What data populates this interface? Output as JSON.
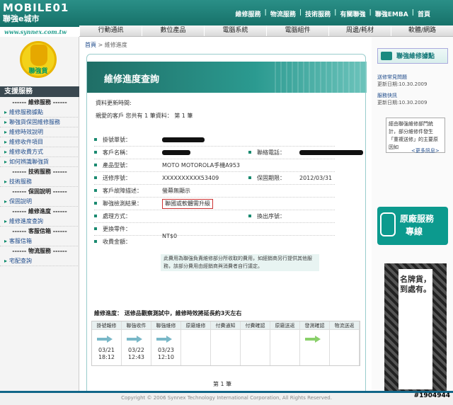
{
  "header": {
    "logo_top": "MOBILE01",
    "logo_bottom": "聯強e城市",
    "url": "www.synnex.com.tw",
    "nav": [
      "維修服務",
      "物流服務",
      "技術服務",
      "有關聯強",
      "聯強EMBA",
      "首頁"
    ]
  },
  "catnav": [
    "行動通訊",
    "數位產品",
    "電腦系統",
    "電腦組件",
    "周邊/耗材",
    "軟體/網路"
  ],
  "sidebar": {
    "badge": "聯強貨",
    "title": "支援服務",
    "groups": [
      {
        "hd": "------ 維修服務 ------",
        "items": [
          "維修服務據點",
          "聯強貨保固維修服務",
          "維修時效說明",
          "維修收件項目",
          "維修收費方式",
          "如何辨識聯強貨"
        ]
      },
      {
        "hd": "------ 技術服務 ------",
        "items": [
          "技術服務"
        ]
      },
      {
        "hd": "------ 保固說明 ------",
        "items": [
          "保固說明"
        ]
      },
      {
        "hd": "------ 維修進度 ------",
        "items": [
          "維修進度查詢"
        ]
      },
      {
        "hd": "------ 客服信箱 ------",
        "items": [
          "客服信箱"
        ]
      },
      {
        "hd": "------ 物流服務 ------",
        "items": [
          "宅配查詢"
        ]
      }
    ]
  },
  "main": {
    "crumb_home": "首頁",
    "crumb_sep": " > ",
    "crumb_cur": "維修進度",
    "panel_title": "維修進度查詢",
    "update_label": "資料更新時間:",
    "greeting": "親愛的客戶 您共有 1 筆資料：  第 1 筆",
    "rows": [
      {
        "k": "掛號單號：",
        "redact": 60
      },
      {
        "k": "客戶名稱：",
        "redact": 40,
        "k2": "聯絡電話：",
        "redact2": 90
      },
      {
        "k": "產品型號：",
        "v": "MOTO MOTOROLA手機A953"
      },
      {
        "k": "送修序號：",
        "v": "XXXXXXXXXX53409",
        "k2": "保固期限：",
        "v2": "2012/03/31"
      },
      {
        "k": "客戶故障描述：",
        "v": "螢幕無顯示"
      },
      {
        "k": "聯強檢測結果：",
        "v": "聯國或軟體需升級",
        "boxed": true
      },
      {
        "k": "處理方式：",
        "k2": "換出序號："
      },
      {
        "k": "更換零件："
      }
    ],
    "fee_label": "收費金額：",
    "fee": "NT$0",
    "note": "此費用為聯強負責維修部分所收取的費用，如經銷商另行提供其他服務，該部分費用由經銷商與消費者自行議定。",
    "progress_title": "維修進度： 送修品觀察測試中，維修時效將延長約3天左右",
    "steps": [
      "掛號報修",
      "聯強收件",
      "聯強維修",
      "原廠維修",
      "付費通知",
      "付費確認",
      "原廠送返",
      "發測確認",
      "物流送返"
    ],
    "step_dates": [
      [
        "03/21",
        "18:12"
      ],
      [
        "03/22",
        "12:43"
      ],
      [
        "03/23",
        "12:10"
      ]
    ],
    "page": "第  1  筆"
  },
  "right": {
    "head": "聯強維修據點",
    "faq": "送修常見問題",
    "faq_date": "更新日期:10.30.2009",
    "news": "服務快訊",
    "news_date": "更新日期:10.30.2009",
    "box": "經由聯強維修部門統計，部分維修件發生「重複送修」的主要原因如",
    "more": "<更多訊息>",
    "svc1": "原廠服務",
    "svc2": "專線",
    "banner": "名牌貨，到處有。"
  },
  "footer": "Copyright © 2006 Synnex Technology International Corporation, All Rights Reserved.",
  "postid": "#1904944",
  "colors": {
    "brand": "#168a80",
    "accent": "#0c9a8e"
  }
}
